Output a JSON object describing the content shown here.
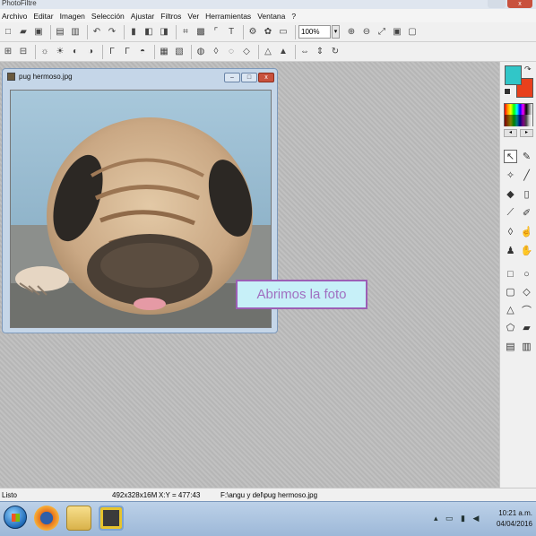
{
  "app": {
    "title": "PhotoFiltre"
  },
  "menu": [
    "Archivo",
    "Editar",
    "Imagen",
    "Selección",
    "Ajustar",
    "Filtros",
    "Ver",
    "Herramientas",
    "Ventana",
    "?"
  ],
  "toolbar": {
    "zoom_value": "100%"
  },
  "document": {
    "title": "pug hermoso.jpg"
  },
  "callout": {
    "text": "Abrimos la foto"
  },
  "colors": {
    "foreground": "#31c6c8",
    "background": "#e8401c",
    "callout_border": "#9c5fb5",
    "callout_fill": "#c7f0f8",
    "callout_text": "#a06fc0"
  },
  "status": {
    "state": "Listo",
    "image_info": "492x328x16M",
    "coords": "X:Y = 477:43",
    "path": "F:\\angu y del\\pug hermoso.jpg"
  },
  "taskbar": {
    "time": "10:21 a.m.",
    "date": "04/04/2016"
  }
}
